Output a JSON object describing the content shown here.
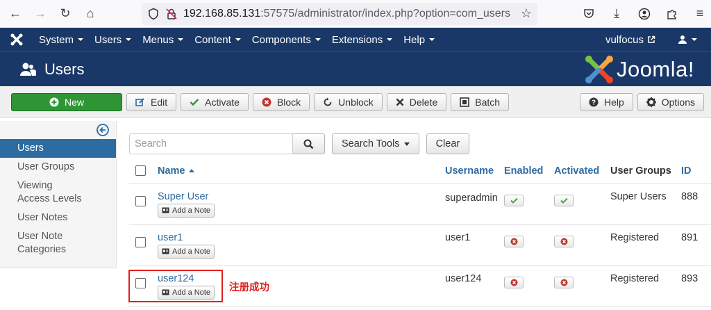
{
  "browser": {
    "url_host": "192.168.85.131",
    "url_rest": ":57575/administrator/index.php?option=com_users"
  },
  "topnav": {
    "menus": [
      "System",
      "Users",
      "Menus",
      "Content",
      "Components",
      "Extensions",
      "Help"
    ],
    "site_name": "vulfocus"
  },
  "titlebar": {
    "title": "Users",
    "logo_text": "Joomla!"
  },
  "toolbar": {
    "new": "New",
    "edit": "Edit",
    "activate": "Activate",
    "block": "Block",
    "unblock": "Unblock",
    "delete": "Delete",
    "batch": "Batch",
    "help": "Help",
    "options": "Options"
  },
  "sidebar": {
    "items": [
      "Users",
      "User Groups",
      "Viewing Access Levels",
      "User Notes",
      "User Note Categories"
    ],
    "active": "Users"
  },
  "filters": {
    "search_placeholder": "Search",
    "search_tools": "Search Tools",
    "clear": "Clear"
  },
  "table": {
    "headers": {
      "name": "Name",
      "username": "Username",
      "enabled": "Enabled",
      "activated": "Activated",
      "groups": "User Groups",
      "id": "ID"
    },
    "rows": [
      {
        "name": "Super User",
        "username": "superadmin",
        "enabled": true,
        "activated": true,
        "groups": "Super Users",
        "id": "888",
        "note": "Add a Note"
      },
      {
        "name": "user1",
        "username": "user1",
        "enabled": false,
        "activated": false,
        "groups": "Registered",
        "id": "891",
        "note": "Add a Note"
      },
      {
        "name": "user124",
        "username": "user124",
        "enabled": false,
        "activated": false,
        "groups": "Registered",
        "id": "893",
        "note": "Add a Note"
      }
    ]
  },
  "annotation": {
    "text": "注册成功",
    "color": "#e02020"
  },
  "colors": {
    "nav": "#1a3867",
    "link": "#2d6ca2",
    "new_button": "#2f9635"
  }
}
